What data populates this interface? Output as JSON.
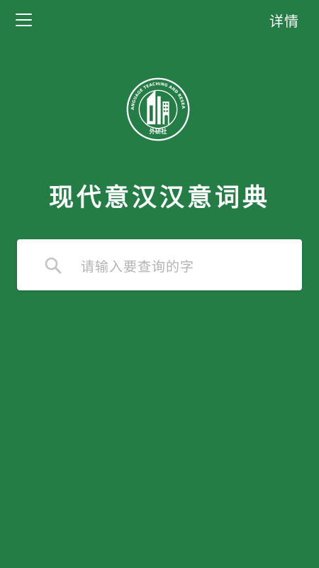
{
  "header": {
    "menu_icon": "hamburger-menu-icon",
    "detail_label": "详情"
  },
  "logo": {
    "arc_text": "FOREIGN LANGUAGE TEACHING AND RESEARCH PRESS",
    "name": "外研社"
  },
  "main": {
    "title": "现代意汉汉意词典"
  },
  "search": {
    "icon": "search-icon",
    "placeholder": "请输入要查询的字"
  },
  "colors": {
    "background": "#237d45",
    "search_background": "#ffffff",
    "placeholder_text": "#b4b4b4",
    "icon_gray": "#c4c4c4"
  }
}
